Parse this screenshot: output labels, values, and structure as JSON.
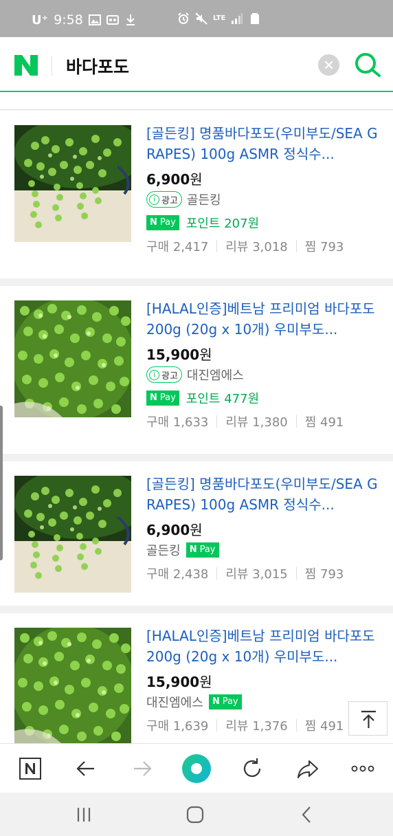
{
  "status_bar": {
    "carrier": "U⁺",
    "time": "9:58",
    "network": "LTE"
  },
  "search": {
    "query": "바다포도",
    "logo": "N"
  },
  "products": [
    {
      "title": "[골든킹] 명품바다포도(우미부도/SEA GRAPES) 100g ASMR 정식수...",
      "price": "6,900",
      "currency": "원",
      "ad": true,
      "ad_label": "광고",
      "seller": "골든킹",
      "pay_position": "point-row",
      "point": "포인트 207원",
      "purchases": "구매 2,417",
      "reviews": "리뷰 3,018",
      "wishes": "찜 793"
    },
    {
      "title": "[HALAL인증]베트남 프리미엄 바다포도 200g (20g x 10개) 우미부도...",
      "price": "15,900",
      "currency": "원",
      "ad": true,
      "ad_label": "광고",
      "seller": "대진엠에스",
      "pay_position": "point-row",
      "point": "포인트 477원",
      "purchases": "구매 1,633",
      "reviews": "리뷰 1,380",
      "wishes": "찜 491"
    },
    {
      "title": "[골든킹] 명품바다포도(우미부도/SEA GRAPES) 100g ASMR 정식수...",
      "price": "6,900",
      "currency": "원",
      "ad": false,
      "seller": "골든킹",
      "pay_position": "seller-row",
      "purchases": "구매 2,438",
      "reviews": "리뷰 3,015",
      "wishes": "찜 793"
    },
    {
      "title": "[HALAL인증]베트남 프리미엄 바다포도 200g (20g x 10개) 우미부도...",
      "price": "15,900",
      "currency": "원",
      "ad": false,
      "seller": "대진엠에스",
      "pay_position": "seller-row",
      "purchases": "구매 1,639",
      "reviews": "리뷰 1,376",
      "wishes": "찜 491"
    }
  ],
  "npay": {
    "n": "N",
    "pay": "Pay"
  },
  "info_glyph": "i",
  "colors": {
    "naver_green": "#03c75a",
    "title_blue": "#1c5fbf",
    "status_gray": "#aeaeae"
  },
  "icons": {
    "toolbar": [
      "naver-home-icon",
      "back-arrow-icon",
      "forward-arrow-icon",
      "green-dot-icon",
      "reload-icon",
      "share-icon",
      "more-icon"
    ],
    "nav": [
      "recent-apps-icon",
      "home-icon",
      "back-icon"
    ]
  }
}
